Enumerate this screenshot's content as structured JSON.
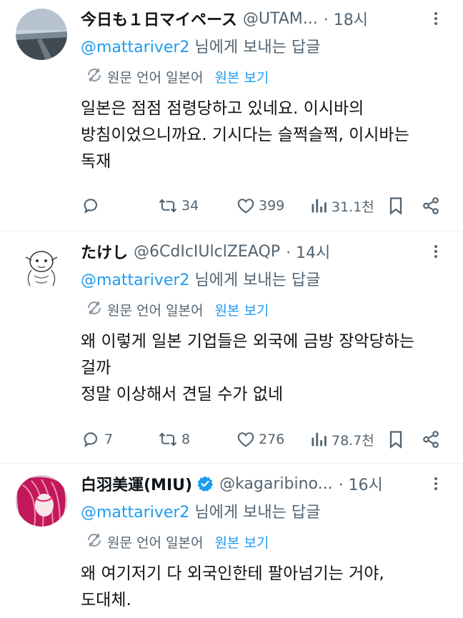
{
  "tweets": [
    {
      "name": "今日も１日マイペース",
      "handle": "@UTAM...",
      "time": "· 18시",
      "reply_mention": "@mattariver2",
      "reply_suffix": " 님에게 보내는 답글",
      "translate_lang": "원문 언어 일본어",
      "translate_link": "원본 보기",
      "body_lines": [
        "일본은 점점 점령당하고 있네요. 이시바의",
        "방침이었으니까요. 기시다는 슬쩍슬쩍, 이시바는",
        "독재"
      ],
      "replies": "",
      "retweets": "34",
      "likes": "399",
      "views": "31.1천"
    },
    {
      "name": "たけし",
      "handle": "@6CdIcIUlclZEAQP",
      "time": "· 14시",
      "reply_mention": "@mattariver2",
      "reply_suffix": " 님에게 보내는 답글",
      "translate_lang": "원문 언어 일본어",
      "translate_link": "원본 보기",
      "body_lines": [
        "왜 이렇게 일본 기업들은 외국에 금방 장악당하는",
        "걸까",
        "정말 이상해서 견딜 수가 없네"
      ],
      "replies": "7",
      "retweets": "8",
      "likes": "276",
      "views": "78.7천"
    },
    {
      "name": "白羽美運(MIU)",
      "handle": "@kagaribino...",
      "time": "· 16시",
      "reply_mention": "@mattariver2",
      "reply_suffix": " 님에게 보내는 답글",
      "translate_lang": "원문 언어 일본어",
      "translate_link": "원본 보기",
      "body_lines": [
        "왜 여기저기 다 외국인한테 팔아넘기는 거야,",
        "도대체."
      ]
    }
  ],
  "icons": {
    "reply": "reply-icon",
    "retweet": "retweet-icon",
    "like": "heart-icon",
    "views": "views-icon",
    "bookmark": "bookmark-icon",
    "share": "share-icon",
    "translate": "translate-icon",
    "verified": "verified-badge-icon",
    "more": "more-options-icon"
  },
  "colors": {
    "text": "#0f1419",
    "muted": "#536471",
    "link": "#1d9bf0",
    "divider": "#eff3f4"
  }
}
